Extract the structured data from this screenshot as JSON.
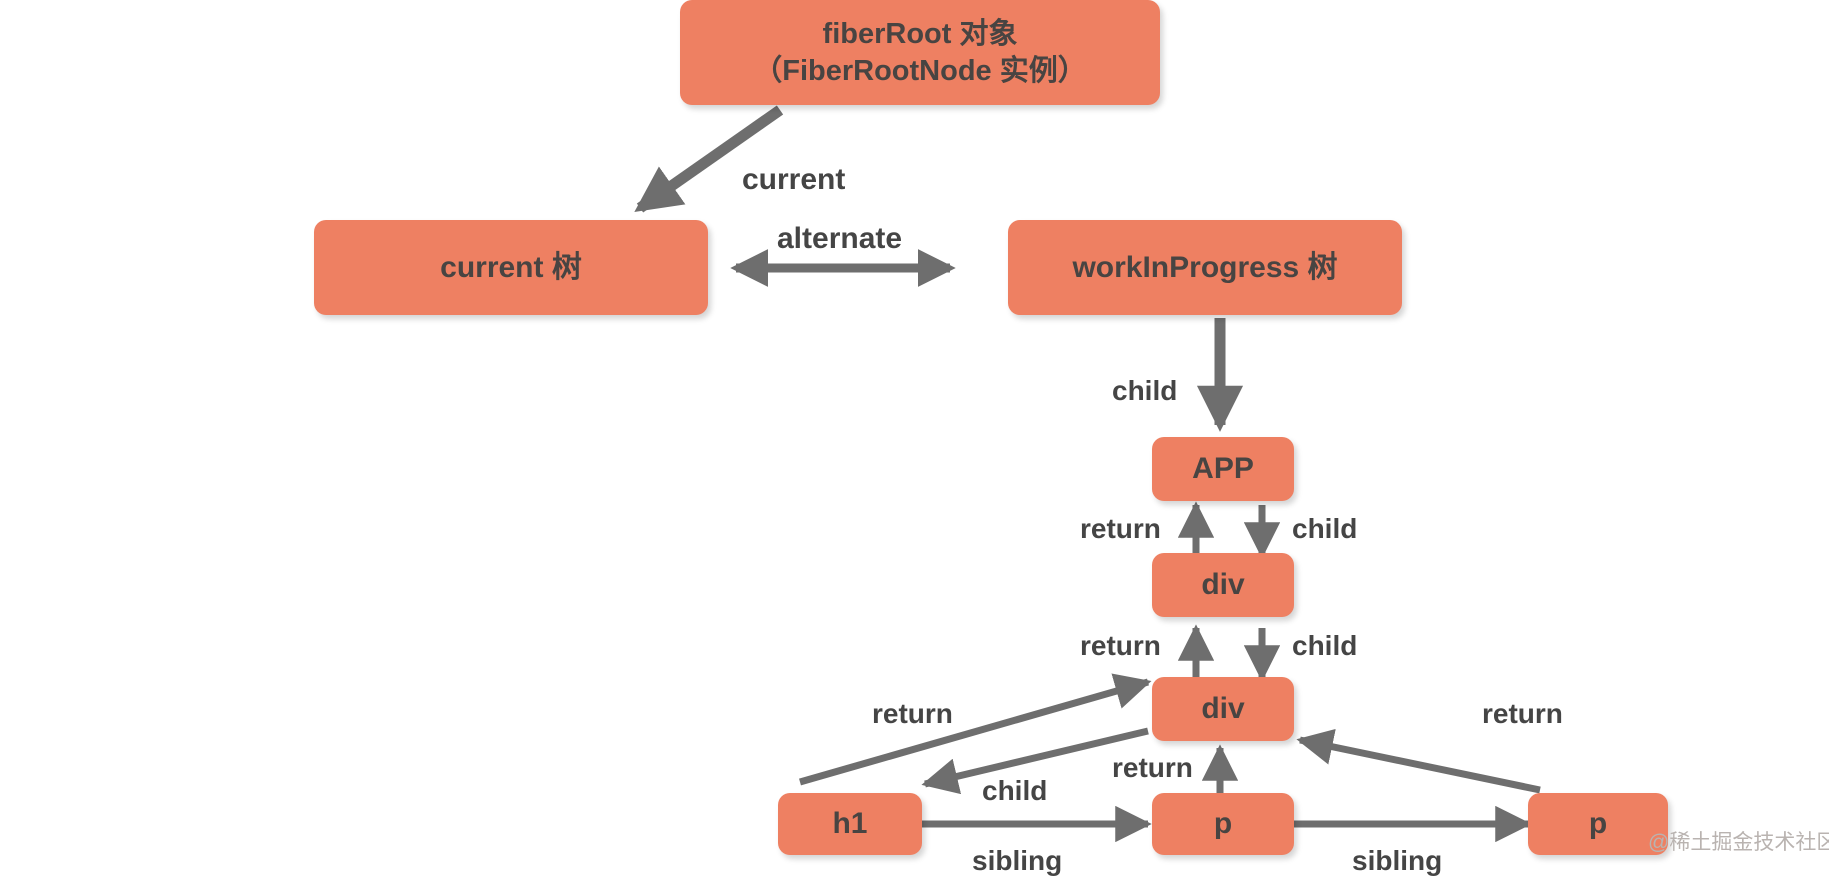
{
  "diagram": {
    "title": "React Fiber double buffering tree structure",
    "background_color": "#ffffff",
    "node_fill_color": "#ee8062",
    "node_text_color": "#484442",
    "edge_color": "#6e6e6e",
    "label_text_color": "#454545",
    "nodes": [
      {
        "id": "fiberRoot",
        "line1": "fiberRoot 对象",
        "line2": "（FiberRootNode 实例）"
      },
      {
        "id": "current",
        "line1": "current 树"
      },
      {
        "id": "wip",
        "line1": "workInProgress 树"
      },
      {
        "id": "app",
        "line1": "APP"
      },
      {
        "id": "div1",
        "line1": "div"
      },
      {
        "id": "div2",
        "line1": "div"
      },
      {
        "id": "h1",
        "line1": "h1"
      },
      {
        "id": "p1",
        "line1": "p"
      },
      {
        "id": "p2",
        "line1": "p"
      }
    ],
    "edge_labels": {
      "current": "current",
      "alternate": "alternate",
      "child_wip_app": "child",
      "return_div1_app": "return",
      "child_app_div1": "child",
      "return_div2_div1": "return",
      "child_div1_div2": "child",
      "return_h1_div2": "return",
      "child_div2_h1": "child",
      "return_p1_div2": "return",
      "return_p2_div2": "return",
      "sibling_h1_p1": "sibling",
      "sibling_p1_p2": "sibling"
    },
    "watermark": "@稀土掘金技术社区"
  }
}
